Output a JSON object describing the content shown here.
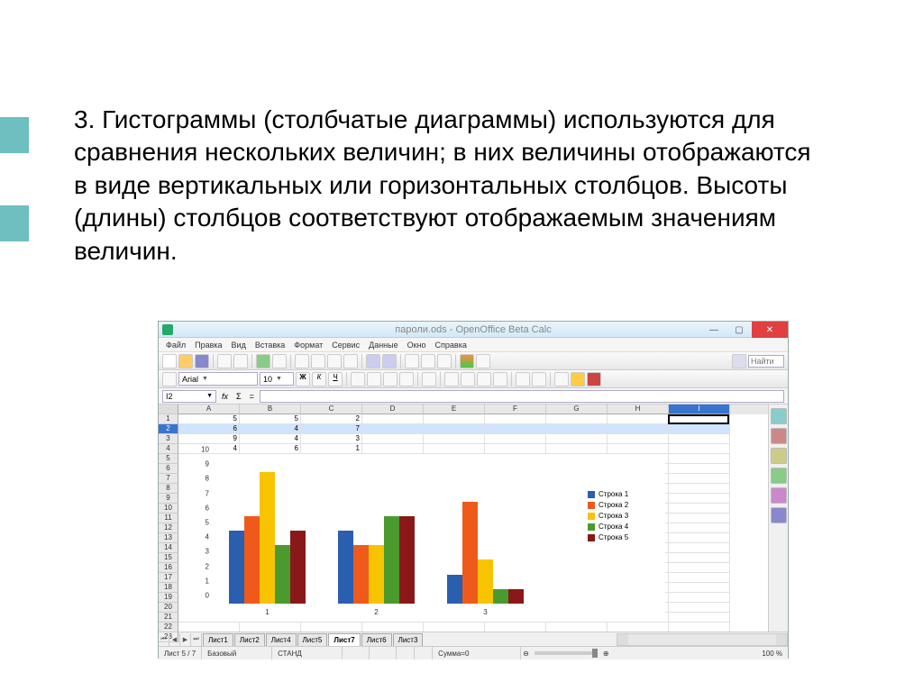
{
  "slide": {
    "text": "3.  Гистограммы (столбчатые диаграммы) используются для сравнения нескольких величин; в них величины отображаются в виде вертикальных или горизонтальных столбцов. Высоты (длины) столбцов соответствуют отображаемым значениям величин."
  },
  "app": {
    "title": "пароли.ods - OpenOffice Beta Calc",
    "window_buttons": {
      "min": "—",
      "max": "▢",
      "close": "✕"
    },
    "menu": [
      "Файл",
      "Правка",
      "Вид",
      "Вставка",
      "Формат",
      "Сервис",
      "Данные",
      "Окно",
      "Справка"
    ],
    "find_label": "Найти",
    "font_name": "Arial",
    "font_size": "10",
    "bold": "Ж",
    "italic": "К",
    "underline": "Ч",
    "cell_ref": "I2",
    "fx": "fx",
    "sigma": "Σ",
    "eq": "=",
    "columns": [
      "A",
      "B",
      "C",
      "D",
      "E",
      "F",
      "G",
      "H",
      "I"
    ],
    "rows_visible": 23,
    "selected_row": 2,
    "data_rows": [
      [
        5,
        5,
        2
      ],
      [
        6,
        4,
        7
      ],
      [
        9,
        4,
        3
      ],
      [
        4,
        6,
        1
      ],
      [
        5,
        6,
        1
      ]
    ],
    "sheet_tabs": [
      "Лист1",
      "Лист2",
      "Лист4",
      "Лист5",
      "Лист7",
      "Лист6",
      "Лист3"
    ],
    "active_tab": 4,
    "status": {
      "sheet": "Лист 5 / 7",
      "style": "Базовый",
      "mode": "СТАНД",
      "sum": "Сумма=0",
      "zoom_minus": "⊖",
      "zoom_plus": "⊕",
      "zoom": "100 %"
    }
  },
  "chart_data": {
    "type": "bar",
    "categories": [
      "1",
      "2",
      "3"
    ],
    "series": [
      {
        "name": "Строка 1",
        "color": "#2a5fb0",
        "values": [
          5,
          5,
          2
        ]
      },
      {
        "name": "Строка 2",
        "color": "#ef5a1a",
        "values": [
          6,
          4,
          7
        ]
      },
      {
        "name": "Строка 3",
        "color": "#f8c300",
        "values": [
          9,
          4,
          3
        ]
      },
      {
        "name": "Строка 4",
        "color": "#4a9a2e",
        "values": [
          4,
          6,
          1
        ]
      },
      {
        "name": "Строка 5",
        "color": "#8a1818",
        "values": [
          5,
          6,
          1
        ]
      }
    ],
    "ylim": [
      0,
      10
    ],
    "yticks": [
      0,
      1,
      2,
      3,
      4,
      5,
      6,
      7,
      8,
      9,
      10
    ],
    "ylabel": "",
    "xlabel": "",
    "title": ""
  },
  "colors": {
    "s1": "#2a5fb0",
    "s2": "#ef5a1a",
    "s3": "#f8c300",
    "s4": "#4a9a2e",
    "s5": "#8a1818"
  }
}
